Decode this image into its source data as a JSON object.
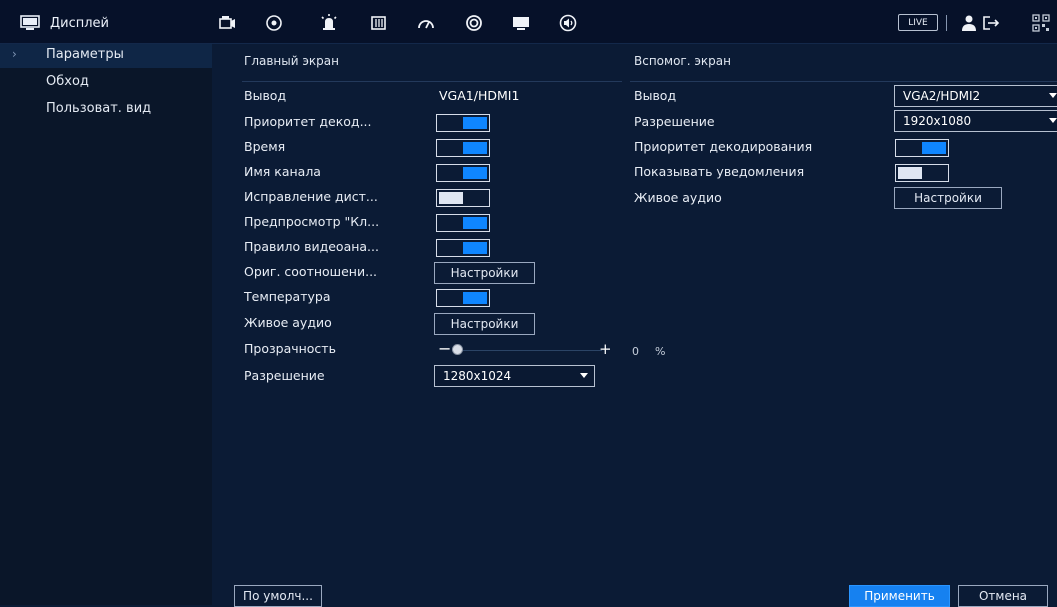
{
  "window": {
    "title": "Дисплей",
    "title_icon": "monitor-icon"
  },
  "toolbar": {
    "icons": [
      "camera-icon",
      "network-icon",
      "event-icon",
      "storage-icon",
      "performance-icon",
      "account-icon",
      "display-icon",
      "audio-icon"
    ],
    "live_label": "LIVE",
    "right_icons": [
      "user-icon",
      "logout-icon",
      "qrcode-icon"
    ]
  },
  "sidebar": {
    "items": [
      {
        "label": "Параметры",
        "active": true
      },
      {
        "label": "Обход",
        "active": false
      },
      {
        "label": "Пользоват. вид",
        "active": false
      }
    ]
  },
  "main_screen": {
    "title": "Главный экран",
    "output_label": "Вывод",
    "output_value": "VGA1/HDMI1",
    "rows": [
      {
        "label": "Приоритет декод...",
        "control": "toggle",
        "on": true
      },
      {
        "label": "Время",
        "control": "toggle",
        "on": true
      },
      {
        "label": "Имя канала",
        "control": "toggle",
        "on": true
      },
      {
        "label": "Исправление дист...",
        "control": "toggle",
        "on": false
      },
      {
        "label": "Предпросмотр \"Кл...",
        "control": "toggle",
        "on": true
      },
      {
        "label": "Правило видеоана...",
        "control": "toggle",
        "on": true
      },
      {
        "label": "Ориг. соотношени...",
        "control": "button",
        "button_label": "Настройки"
      },
      {
        "label": "Температура",
        "control": "toggle",
        "on": true
      },
      {
        "label": "Живое аудио",
        "control": "button",
        "button_label": "Настройки"
      }
    ],
    "transparency": {
      "label": "Прозрачность",
      "value": "0",
      "unit": "%"
    },
    "resolution": {
      "label": "Разрешение",
      "value": "1280x1024"
    }
  },
  "aux_screen": {
    "title": "Вспомог. экран",
    "rows": [
      {
        "label": "Вывод",
        "control": "select",
        "value": "VGA2/HDMI2"
      },
      {
        "label": "Разрешение",
        "control": "select",
        "value": "1920x1080"
      },
      {
        "label": "Приоритет декодирования",
        "control": "toggle",
        "on": true
      },
      {
        "label": "Показывать уведомления",
        "control": "toggle",
        "on": false
      },
      {
        "label": "Живое аудио",
        "control": "button",
        "button_label": "Настройки"
      }
    ]
  },
  "footer": {
    "default_label": "По умолч...",
    "apply_label": "Применить",
    "cancel_label": "Отмена"
  },
  "colors": {
    "accent": "#1681f0",
    "background": "#0b1b35",
    "sidebar": "#0a1629",
    "topbar": "#061129"
  }
}
